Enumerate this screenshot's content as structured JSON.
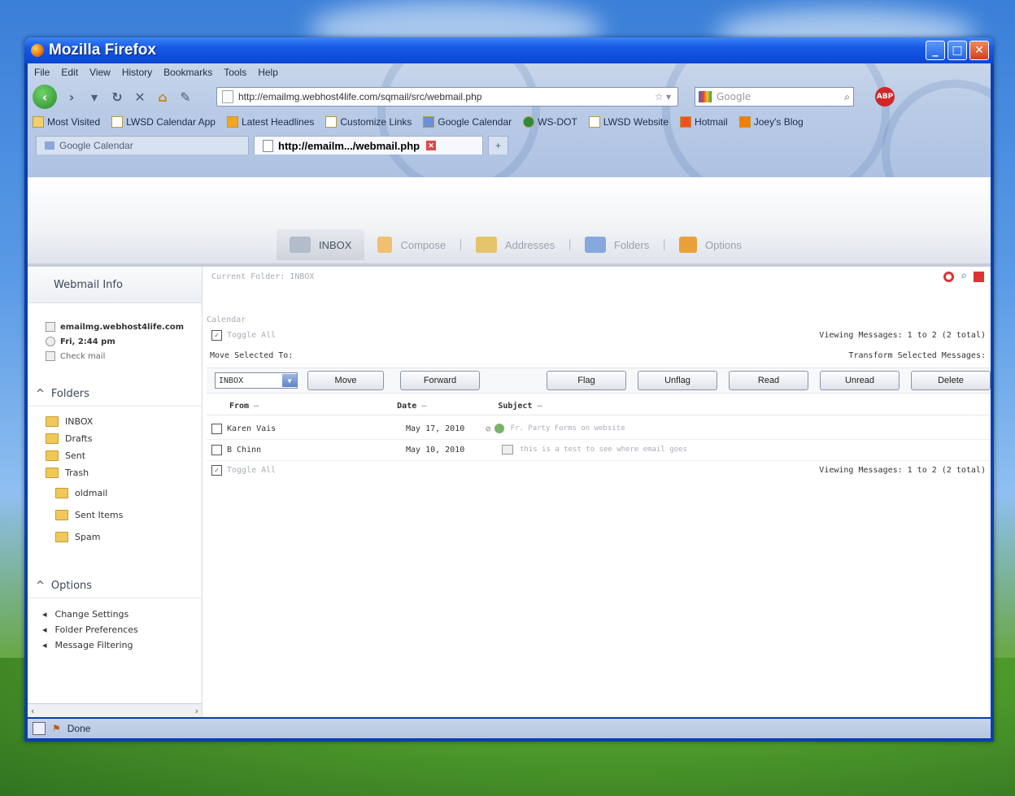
{
  "window": {
    "title": "Mozilla Firefox"
  },
  "menu": [
    "File",
    "Edit",
    "View",
    "History",
    "Bookmarks",
    "Tools",
    "Help"
  ],
  "nav": {
    "url": "http://emailmg.webhost4life.com/sqmail/src/webmail.php",
    "search_placeholder": "Google"
  },
  "bookmarks": [
    "Most Visited",
    "LWSD Calendar App",
    "Latest Headlines",
    "Customize Links",
    "Google Calendar",
    "WS-DOT",
    "LWSD Website",
    "Hotmail",
    "Joey's Blog"
  ],
  "browser_tabs": [
    {
      "label": "Google Calendar"
    },
    {
      "label": "http://emailm.../webmail.php"
    }
  ],
  "app_tabs": [
    "INBOX",
    "Compose",
    "Addresses",
    "Folders",
    "Options"
  ],
  "sidebar": {
    "webmail_info_title": "Webmail Info",
    "host": "emailmg.webhost4life.com",
    "datetime": "Fri, 2:44 pm",
    "check_mail": "Check mail",
    "folders_title": "Folders",
    "folders": [
      {
        "name": "INBOX",
        "color": "#f0c85a"
      },
      {
        "name": "Drafts",
        "color": "#f0c85a"
      },
      {
        "name": "Sent",
        "color": "#f0c85a"
      },
      {
        "name": "Trash",
        "color": "#f0c85a"
      }
    ],
    "sub_folders": [
      "oldmail",
      "Sent Items",
      "Spam"
    ],
    "options_title": "Options",
    "options": [
      "Change Settings",
      "Folder Preferences",
      "Message Filtering"
    ]
  },
  "main": {
    "current_folder": "Current Folder: INBOX",
    "calendar_label": "Calendar",
    "toggle_all": "Toggle All",
    "viewing_top": "Viewing Messages: 1 to 2 (2 total)",
    "move_selected_to": "Move Selected To:",
    "transform_selected": "Transform Selected Messages:",
    "folder_select_value": "INBOX",
    "buttons": {
      "move": "Move",
      "forward": "Forward",
      "flag": "Flag",
      "unflag": "Unflag",
      "read": "Read",
      "unread": "Unread",
      "delete": "Delete"
    },
    "columns": {
      "from": "From",
      "date": "Date",
      "subject": "Subject"
    },
    "messages": [
      {
        "from": "Karen Vais",
        "date": "May 17, 2010",
        "subject": "Fr. Party Forms on website"
      },
      {
        "from": "B Chinn",
        "date": "May 10, 2010",
        "subject": "this is a test to see where email goes"
      }
    ],
    "viewing_bottom": "Viewing Messages: 1 to 2 (2 total)"
  },
  "status": {
    "text": "Done"
  }
}
